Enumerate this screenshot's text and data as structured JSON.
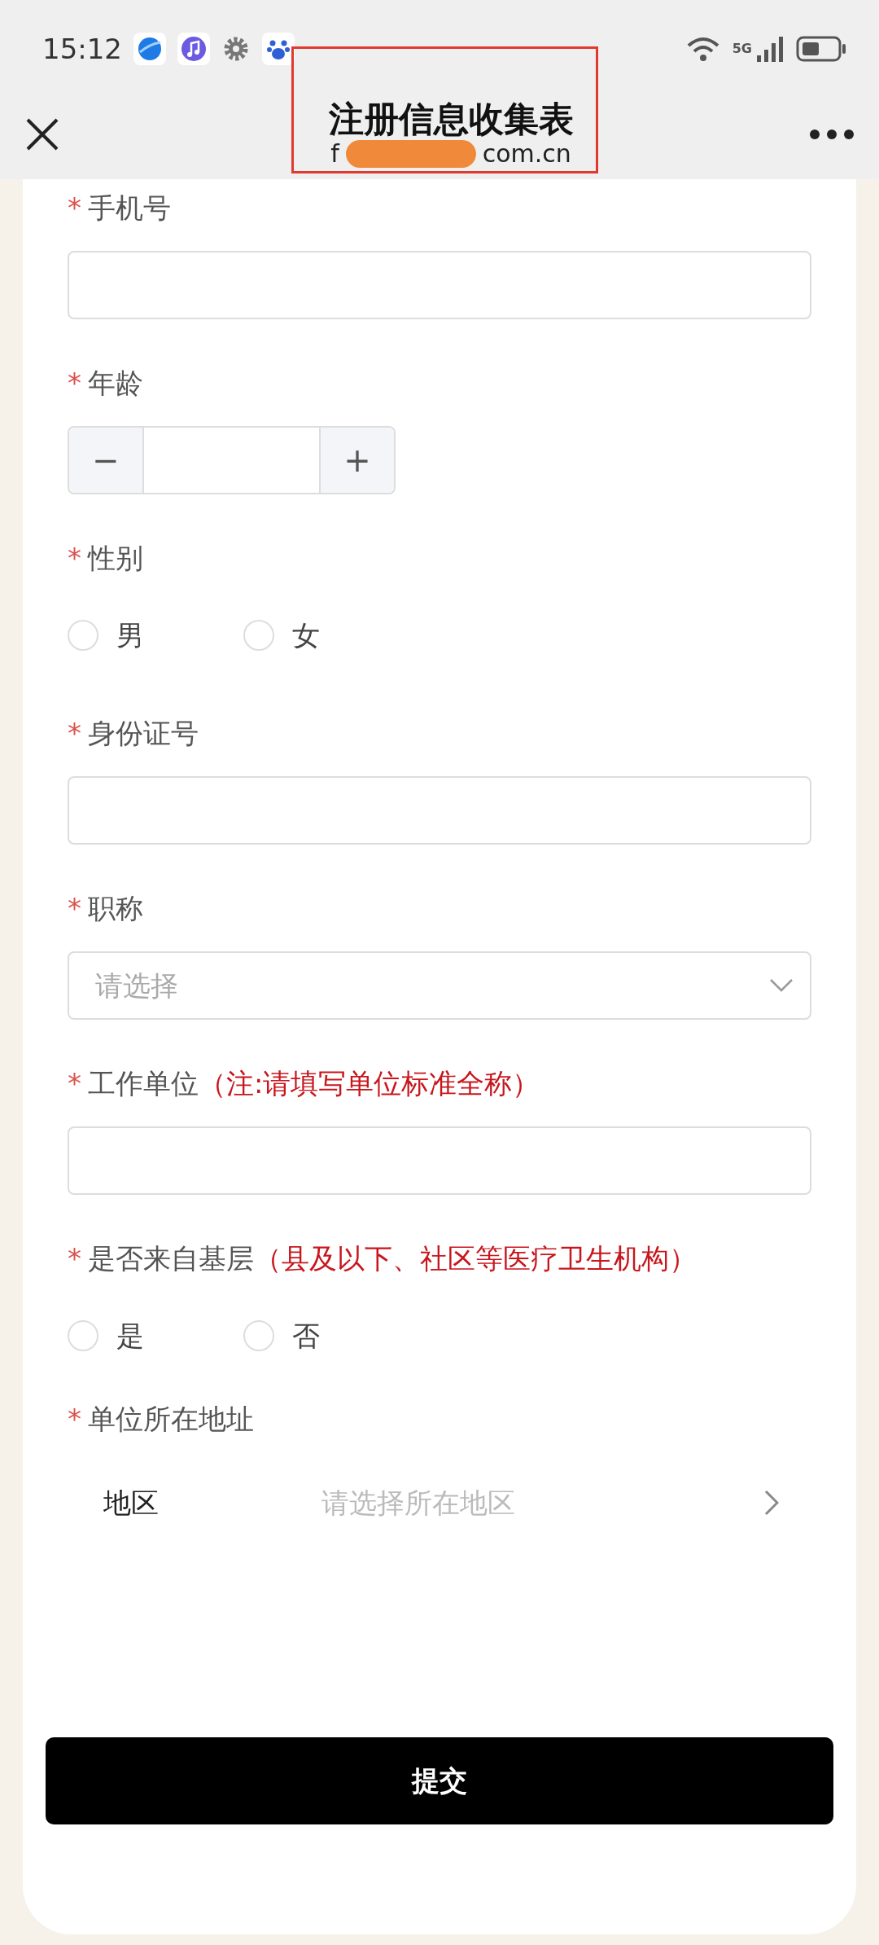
{
  "status_bar": {
    "time": "15:12",
    "network": "5G"
  },
  "header": {
    "title": "注册信息收集表",
    "url_start": "f",
    "url_end": "com.cn",
    "redacted": true,
    "highlight_box": true
  },
  "fields": [
    {
      "kind": "text",
      "marker": "*",
      "label": "手机号"
    },
    {
      "kind": "stepper",
      "marker": "*",
      "label": "年龄",
      "minus": "−",
      "plus": "+"
    },
    {
      "kind": "radio",
      "marker": "*",
      "label": "性别",
      "options": [
        {
          "label": "男",
          "selected": false
        },
        {
          "label": "女",
          "selected": false
        }
      ]
    },
    {
      "kind": "text",
      "marker": "*",
      "label": "身份证号"
    },
    {
      "kind": "select",
      "marker": "*",
      "label": "职称",
      "placeholder": "请选择"
    },
    {
      "kind": "text",
      "marker": "*",
      "label": "工作单位",
      "note": "（注:请填写单位标准全称）"
    },
    {
      "kind": "radio",
      "marker": "*",
      "label": "是否来自基层",
      "note": "（县及以下、社区等医疗卫生机构）",
      "options": [
        {
          "label": "是",
          "selected": false
        },
        {
          "label": "否",
          "selected": false
        }
      ]
    },
    {
      "kind": "address",
      "marker": "*",
      "label": "单位所在地址",
      "row_label": "地区",
      "placeholder": "请选择所在地区"
    }
  ],
  "submit": "提交"
}
